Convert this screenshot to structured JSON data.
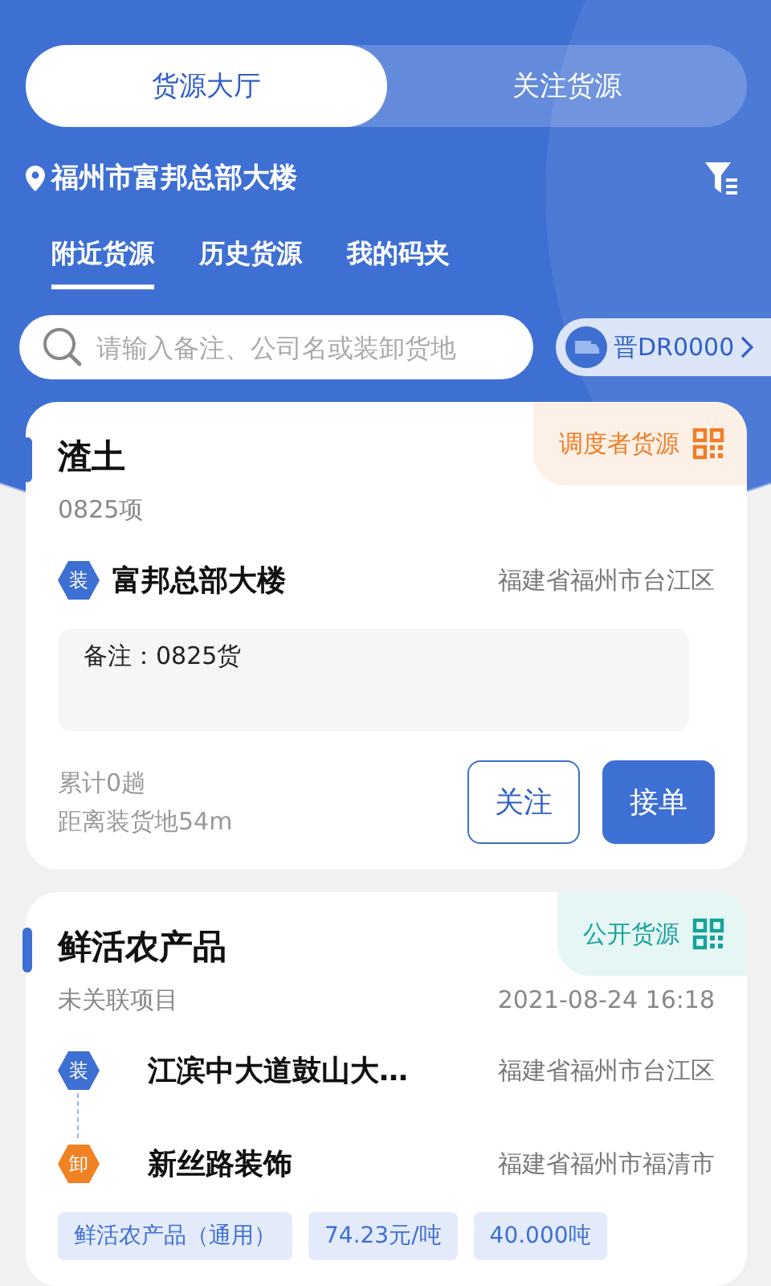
{
  "top_tabs": [
    {
      "label": "货源大厅",
      "selected": true
    },
    {
      "label": "关注货源",
      "selected": false
    }
  ],
  "location": "福州市富邦总部大楼",
  "sub_tabs": [
    {
      "label": "附近货源",
      "selected": true
    },
    {
      "label": "历史货源",
      "selected": false
    },
    {
      "label": "我的码夹",
      "selected": false
    }
  ],
  "search": {
    "placeholder": "请输入备注、公司名或装卸货地"
  },
  "vehicle": "晋DR0000",
  "cards": [
    {
      "title": "渣土",
      "source": {
        "kind": "dispatcher",
        "label": "调度者货源"
      },
      "project": "0825项",
      "stops": [
        {
          "kind": "load",
          "mark": "装",
          "name": "富邦总部大楼",
          "region": "福建省福州市台江区"
        }
      ],
      "note": "备注：0825货",
      "trips": "累计0趟",
      "distance": "距离装货地54m",
      "buttons": [
        {
          "kind": "outline",
          "label": "关注"
        },
        {
          "kind": "primary",
          "label": "接单"
        }
      ]
    },
    {
      "title": "鲜活农产品",
      "source": {
        "kind": "public",
        "label": "公开货源"
      },
      "project": "未关联项目",
      "time": "2021-08-24 16:18",
      "stops": [
        {
          "kind": "load",
          "mark": "装",
          "name": "江滨中大道鼓山大…",
          "region": "福建省福州市台江区"
        },
        {
          "kind": "unload",
          "mark": "卸",
          "name": "新丝路装饰",
          "region": "福建省福州市福清市"
        }
      ],
      "tags": [
        "鲜活农产品（通用）",
        "74.23元/吨",
        "40.000吨"
      ]
    }
  ]
}
